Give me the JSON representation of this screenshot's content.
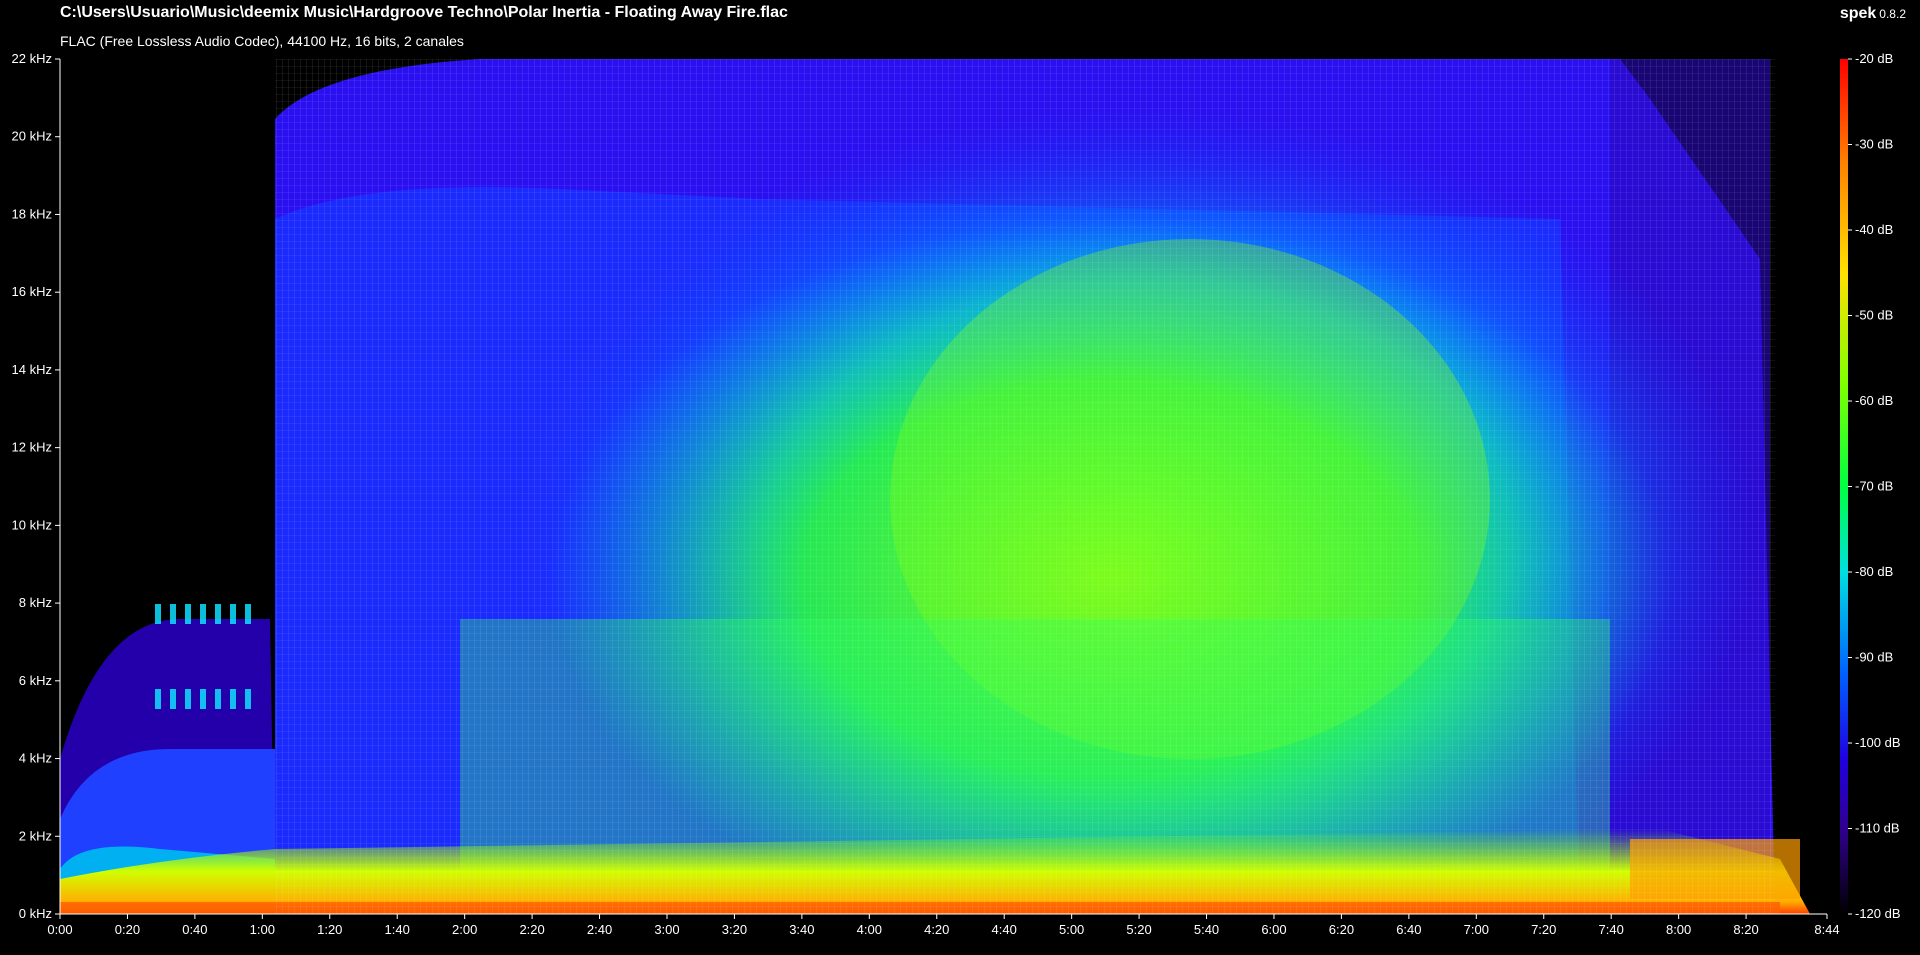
{
  "header": {
    "file_path": "C:\\Users\\Usuario\\Music\\deemix Music\\Hardgroove Techno\\Polar Inertia - Floating Away Fire.flac",
    "file_info": "FLAC (Free Lossless Audio Codec), 44100 Hz, 16 bits, 2 canales",
    "app_name": "spek",
    "app_version": "0.8.2"
  },
  "frequency_axis": [
    "0 kHz",
    "2 kHz",
    "4 kHz",
    "6 kHz",
    "8 kHz",
    "10 kHz",
    "12 kHz",
    "14 kHz",
    "16 kHz",
    "18 kHz",
    "20 kHz",
    "22 kHz"
  ],
  "time_axis": [
    "0:00",
    "0:20",
    "0:40",
    "1:00",
    "1:20",
    "1:40",
    "2:00",
    "2:20",
    "2:40",
    "3:00",
    "3:20",
    "3:40",
    "4:00",
    "4:20",
    "4:40",
    "5:00",
    "5:20",
    "5:40",
    "6:00",
    "6:20",
    "6:40",
    "7:00",
    "7:20",
    "7:40",
    "8:00",
    "8:20",
    "8:44"
  ],
  "db_scale": [
    "-20 dB",
    "-30 dB",
    "-40 dB",
    "-50 dB",
    "-60 dB",
    "-70 dB",
    "-80 dB",
    "-90 dB",
    "-100 dB",
    "-110 dB",
    "-120 dB"
  ],
  "colors": {
    "background": "#000000",
    "scale": [
      "#ff0000",
      "#ff8000",
      "#ffe000",
      "#80ff00",
      "#00ff40",
      "#00e0e0",
      "#0060ff",
      "#2000e0",
      "#300090",
      "#1a0040",
      "#000000"
    ]
  }
}
